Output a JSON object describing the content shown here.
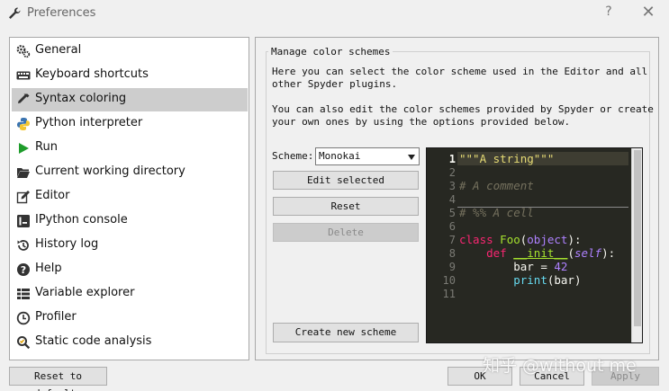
{
  "window": {
    "title": "Preferences",
    "help_symbol": "?",
    "close_symbol": "✕"
  },
  "sidebar": {
    "items": [
      {
        "label": "General",
        "icon": "gear-icon"
      },
      {
        "label": "Keyboard shortcuts",
        "icon": "keyboard-icon"
      },
      {
        "label": "Syntax coloring",
        "icon": "eyedropper-icon",
        "selected": true
      },
      {
        "label": "Python interpreter",
        "icon": "python-icon"
      },
      {
        "label": "Run",
        "icon": "play-icon"
      },
      {
        "label": "Current working directory",
        "icon": "folder-icon"
      },
      {
        "label": "Editor",
        "icon": "edit-icon"
      },
      {
        "label": "IPython console",
        "icon": "console-icon"
      },
      {
        "label": "History log",
        "icon": "history-icon"
      },
      {
        "label": "Help",
        "icon": "help-icon"
      },
      {
        "label": "Variable explorer",
        "icon": "list-icon"
      },
      {
        "label": "Profiler",
        "icon": "clock-icon"
      },
      {
        "label": "Static code analysis",
        "icon": "analysis-icon"
      }
    ]
  },
  "panel": {
    "group_title": "Manage color schemes",
    "desc1_line1": "Here you can select the color scheme used in the Editor and all",
    "desc1_line2": "other Spyder plugins.",
    "desc2_line1": "You can also edit the color schemes provided by Spyder or create",
    "desc2_line2": "your own ones by using the options provided below.",
    "scheme_label": "Scheme:",
    "scheme_value": "Monokai",
    "edit_button": "Edit selected",
    "reset_button": "Reset",
    "delete_button": "Delete",
    "create_button": "Create new scheme"
  },
  "editor_preview": {
    "line_numbers": [
      "1",
      "2",
      "3",
      "4",
      "5",
      "6",
      "7",
      "8",
      "9",
      "10",
      "11"
    ],
    "current_line": 1,
    "line1": "\"\"\"A string\"\"\"",
    "line3": "# A comment",
    "line5": "# %% A cell",
    "l7_kw": "class",
    "l7_cls": "Foo",
    "l7_p1": "(",
    "l7_base": "object",
    "l7_p2": "):",
    "l8_kw": "def",
    "l8_fn": "__init__",
    "l8_p1": "(",
    "l8_self": "self",
    "l8_p2": "):",
    "l9_var": "bar = ",
    "l9_num": "42",
    "l10_fn": "print",
    "l10_args": "(bar)"
  },
  "footer": {
    "reset_defaults": "Reset to defaults",
    "ok": "OK",
    "cancel": "Cancel",
    "apply": "Apply"
  },
  "watermark": "知乎 @without me",
  "colors": {
    "editor_bg": "#272822",
    "string": "#e6db74",
    "comment": "#75715e",
    "keyword": "#f92672",
    "class_name": "#a6e22e",
    "number": "#ae81ff"
  }
}
